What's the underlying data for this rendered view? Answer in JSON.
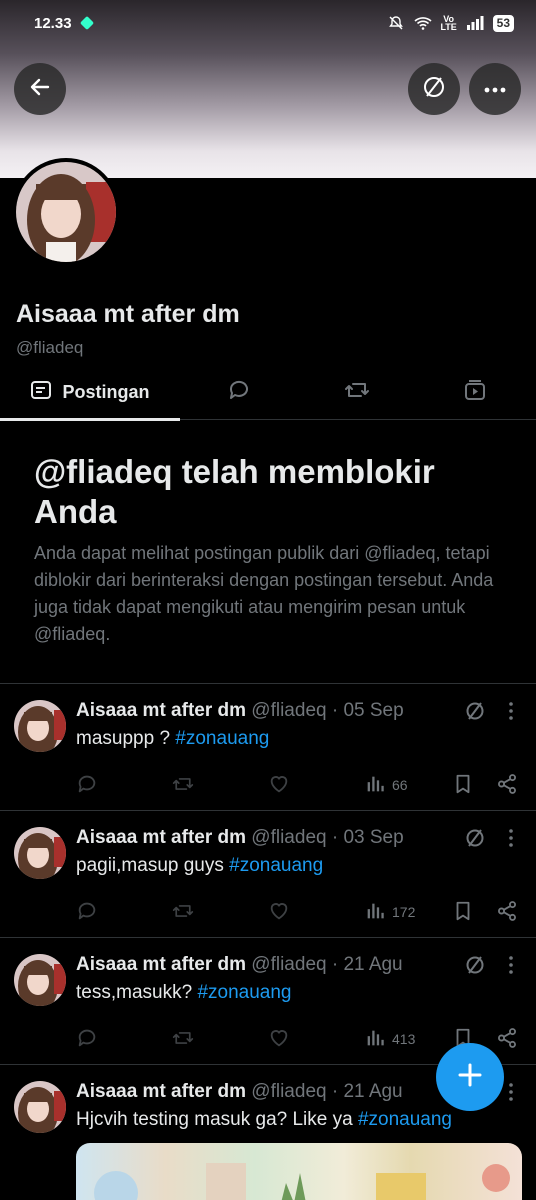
{
  "status_bar": {
    "time": "12.33",
    "battery": "53"
  },
  "profile": {
    "name": "Aisaaa mt after dm",
    "handle": "@fliadeq"
  },
  "tabs": {
    "posts_label": "Postingan"
  },
  "blocked": {
    "title": "@fliadeq telah memblokir Anda",
    "description": "Anda dapat melihat postingan publik dari @fliadeq, tetapi diblokir dari berinteraksi dengan postingan tersebut. Anda juga tidak dapat mengikuti atau mengirim pesan untuk @fliadeq."
  },
  "posts": [
    {
      "name": "Aisaaa mt after dm",
      "meta": "@fliadeq · 05 Sep",
      "text": "masuppp ? ",
      "hashtag": "#zonauang",
      "views": "66"
    },
    {
      "name": "Aisaaa mt after dm",
      "meta": "@fliadeq · 03 Sep",
      "text": "pagii,masup guys ",
      "hashtag": "#zonauang",
      "views": "172"
    },
    {
      "name": "Aisaaa mt after dm",
      "meta": "@fliadeq · 21 Agu",
      "text": "tess,masukk? ",
      "hashtag": "#zonauang",
      "views": "413"
    },
    {
      "name": "Aisaaa mt after dm",
      "meta": "@fliadeq · 21 Agu",
      "text": "Hjcvih testing masuk ga? Like ya ",
      "hashtag": "#zonauang"
    }
  ],
  "icons": {
    "back": "arrow-left-icon",
    "follow": "unfollow-slash-icon",
    "more": "more-horizontal-icon",
    "compose": "plus-icon"
  },
  "colors": {
    "accent": "#1d9bf0",
    "muted": "#71767b",
    "text": "#e7e9ea",
    "divider": "#2f3336"
  }
}
